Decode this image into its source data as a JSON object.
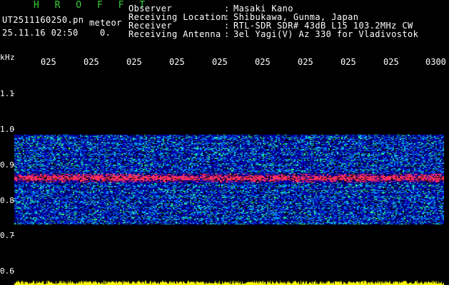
{
  "header": {
    "app_title": "H R O F F T",
    "filename": "UT2511160250.pn",
    "mode": "meteor",
    "datetime": "25.11.16 02:50",
    "count": "0.",
    "info": [
      {
        "label": "Observer",
        "value": "Masaki Kano"
      },
      {
        "label": "Receiving Location",
        "value": "Shibukawa, Gunma, Japan"
      },
      {
        "label": "Receiver",
        "value": "RTL-SDR SDR# 43dB L15 103.2MHz CW"
      },
      {
        "label": "Receiving Antenna",
        "value": "3el Yagi(V) Az 330 for Vladivostok"
      }
    ],
    "separator": ":"
  },
  "y_axis": {
    "unit": "kHz",
    "ticks": [
      "1.1",
      "1.0",
      "0.9",
      "0.8",
      "0.7",
      "0.6"
    ]
  },
  "x_axis": {
    "ticks": [
      "025",
      "025",
      "025",
      "025",
      "025",
      "025",
      "025",
      "025",
      "025",
      "0300"
    ]
  },
  "spectrogram": {
    "freq_range_khz": [
      0.77,
      1.02
    ],
    "strong_band_khz": 0.9,
    "colors": {
      "background": "#000000",
      "noise_low": "#0000aa",
      "noise_mid": "#00a0ff",
      "noise_high": "#30ff80",
      "peak": "#ff3060",
      "level_trace": "#ffff00"
    }
  }
}
